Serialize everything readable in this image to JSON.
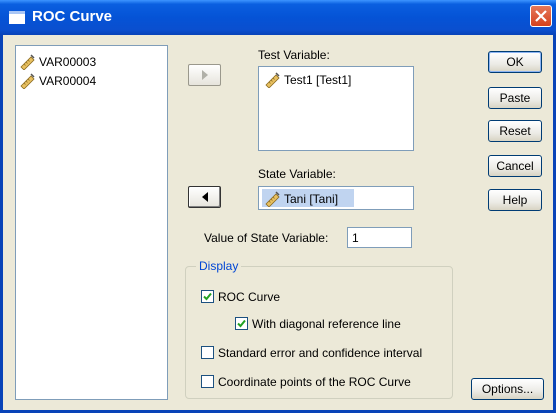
{
  "window": {
    "title": "ROC Curve"
  },
  "variables": [
    "VAR00003",
    "VAR00004"
  ],
  "test_variable": {
    "label": "Test Variable:",
    "items": [
      "Test1 [Test1]"
    ]
  },
  "state_variable": {
    "label": "State Variable:",
    "value": "Tani [Tani]"
  },
  "state_value": {
    "label": "Value of State Variable:",
    "value": "1"
  },
  "display": {
    "label": "Display",
    "roc_curve": {
      "label": "ROC Curve",
      "checked": true
    },
    "diagonal": {
      "label": "With diagonal reference line",
      "checked": true
    },
    "std_error": {
      "label": "Standard error and confidence interval",
      "checked": false
    },
    "coord_points": {
      "label": "Coordinate points of the ROC Curve",
      "checked": false
    }
  },
  "buttons": {
    "ok": "OK",
    "paste": "Paste",
    "reset": "Reset",
    "cancel": "Cancel",
    "help": "Help",
    "options": "Options..."
  },
  "colors": {
    "titlebar": "#0553d6",
    "dialog_bg": "#ece9d8",
    "group_label": "#0046d5"
  },
  "icons": {
    "variable": "ruler-pencil-icon"
  }
}
